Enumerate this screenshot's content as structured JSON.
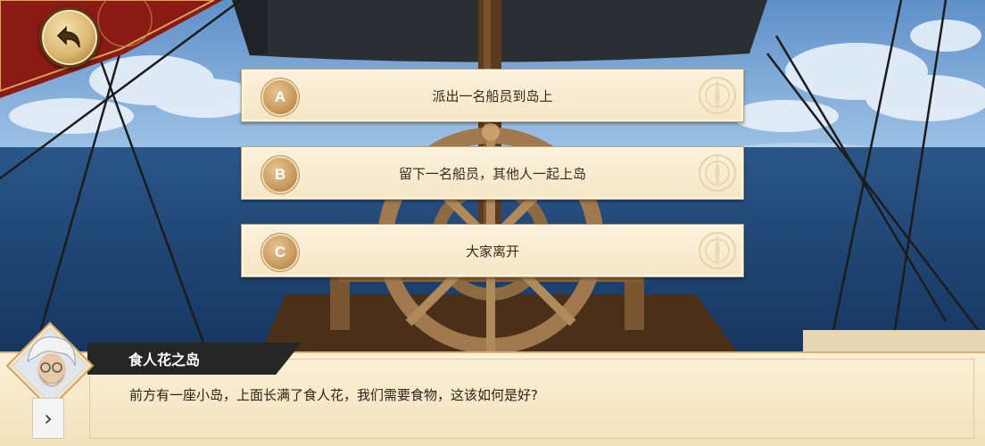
{
  "choices": [
    {
      "letter": "A",
      "text": "派出一名船员到岛上"
    },
    {
      "letter": "B",
      "text": "留下一名船员，其他人一起上岛"
    },
    {
      "letter": "C",
      "text": "大家离开"
    }
  ],
  "dialog": {
    "speaker": "食人花之岛",
    "text": "前方有一座小岛，上面长满了食人花，我们需要食物，这该如何是好?"
  },
  "icons": {
    "back": "back-arrow-icon",
    "next": "chevron-right-icon",
    "next_glyph": "›"
  },
  "colors": {
    "sky": "#6ea0d6",
    "sea": "#1a3d6b",
    "panel": "#f6e6c6",
    "badge": "#c89a5e",
    "name_tab": "#262626"
  }
}
